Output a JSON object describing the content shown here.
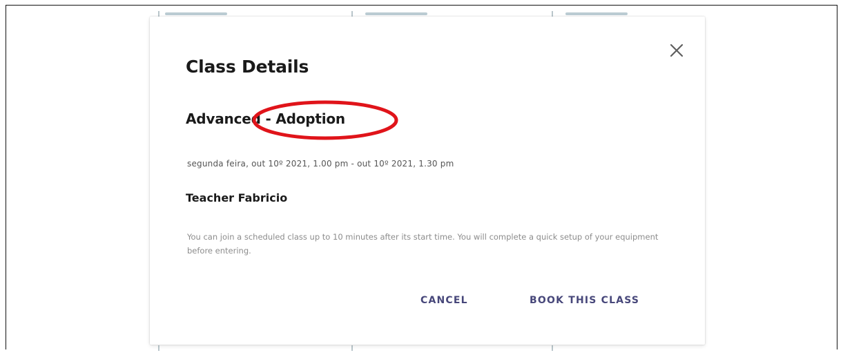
{
  "dialog": {
    "title": "Class Details",
    "class_name": "Advanced - Adoption",
    "datetime": "segunda feira, out 10º 2021, 1.00 pm  -  out 10º 2021, 1.30 pm",
    "teacher": "Teacher Fabricio",
    "note": "You can join a scheduled class up to 10 minutes after its start time. You will complete a quick setup of your equipment before entering.",
    "cancel_label": "CANCEL",
    "book_label": "BOOK THIS CLASS",
    "close_icon": "close-icon"
  },
  "annotation": {
    "type": "red-ellipse",
    "color": "#e0141a"
  },
  "colors": {
    "action": "#47477a",
    "title": "#1a1a1a",
    "muted": "#8c8c8c"
  }
}
